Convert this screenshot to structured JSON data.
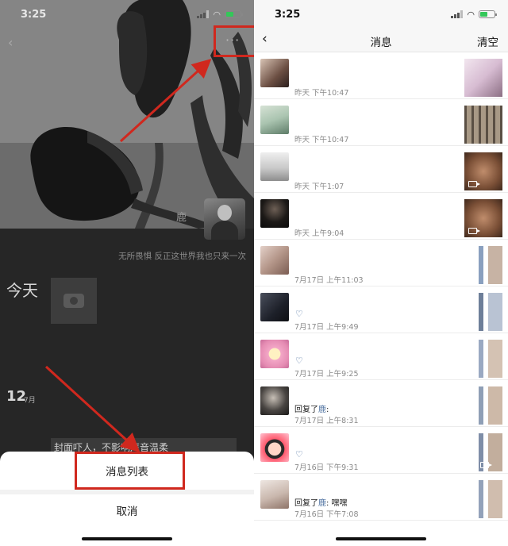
{
  "left": {
    "status_time": "3:25",
    "nickname": "鹿",
    "signature": "无所畏惧 反正这世界我也只来一次",
    "today_label": "今天",
    "date_day": "12",
    "date_month": "7月",
    "post_text": "封面吓人，不影响声音温柔",
    "sheet": {
      "primary_label": "消息列表",
      "cancel_label": "取消"
    },
    "colors": {
      "highlight": "#d0281e"
    }
  },
  "right": {
    "status_time": "3:25",
    "nav": {
      "back_icon": "chevron-left-icon",
      "title": "消息",
      "clear_label": "清空"
    },
    "messages": [
      {
        "time": "昨天 下午10:47",
        "reply": "",
        "heart": false,
        "video": false
      },
      {
        "time": "昨天 下午10:47",
        "reply": "",
        "heart": false,
        "video": false
      },
      {
        "time": "昨天 下午1:07",
        "reply": "",
        "heart": false,
        "video": true
      },
      {
        "time": "昨天 上午9:04",
        "reply": "",
        "heart": false,
        "video": true
      },
      {
        "time": "7月17日 上午11:03",
        "reply": "",
        "heart": false,
        "video": false
      },
      {
        "time": "7月17日 上午9:49",
        "reply": "",
        "heart": true,
        "video": false
      },
      {
        "time": "7月17日 上午9:25",
        "reply": "",
        "heart": true,
        "video": false
      },
      {
        "time": "7月17日 上午8:31",
        "reply_prefix": "回复了",
        "reply_name": "鹿",
        "reply_suffix": ":",
        "heart": false,
        "video": false
      },
      {
        "time": "7月16日 下午9:31",
        "reply": "",
        "heart": true,
        "video": true
      },
      {
        "time": "7月16日 下午7:08",
        "reply_prefix": "回复了",
        "reply_name": "鹿",
        "reply_suffix": ": 嘿嘿",
        "heart": false,
        "video": false
      }
    ],
    "colors": {
      "name_link": "#4a6e9e",
      "time_text": "#8a8a8a"
    }
  }
}
